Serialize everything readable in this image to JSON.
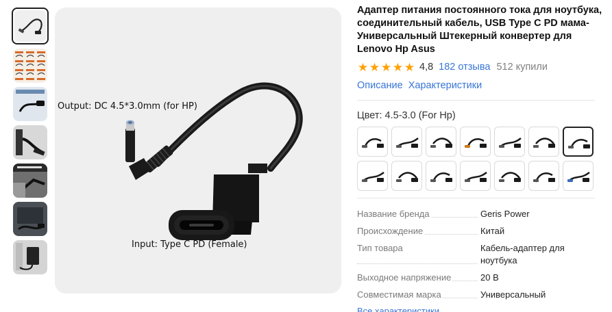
{
  "product": {
    "title": "Адаптер питания постоянного тока для ноутбука, соединительный кабель, USB Type C PD мама-Универсальный Штекерный конвертер для Lenovo Hp Asus",
    "rating_value": "4,8",
    "rating_stars": 5,
    "reviews_text": "182 отзыва",
    "bought_text": "512 купили"
  },
  "tabs": {
    "description": "Описание",
    "specifications": "Характеристики"
  },
  "image": {
    "caption_output": "Output: DC 4.5*3.0mm (for HP)",
    "caption_input": "Input: Type C PD (Female)"
  },
  "thumbnails": [
    {
      "name": "thumb-hp-cable",
      "active": true
    },
    {
      "name": "thumb-variants-grid",
      "active": false
    },
    {
      "name": "thumb-small-portable",
      "active": false
    },
    {
      "name": "thumb-laptop-connection",
      "active": false
    },
    {
      "name": "thumb-plug-and-charge",
      "active": false
    },
    {
      "name": "thumb-laptop-dark",
      "active": false
    },
    {
      "name": "thumb-charger",
      "active": false
    }
  ],
  "color": {
    "label": "Цвет: 4.5-3.0 (For Hp)",
    "selected_index": 6,
    "swatch_count": 14
  },
  "specs": [
    {
      "key": "Название бренда",
      "value": "Geris Power"
    },
    {
      "key": "Происхождение",
      "value": "Китай"
    },
    {
      "key": "Тип товара",
      "value": "Кабель-адаптер для ноутбука"
    },
    {
      "key": "Выходное напряжение",
      "value": "20 В"
    },
    {
      "key": "Совместимая марка",
      "value": "Универсальный"
    }
  ],
  "all_specs_link": "Все характеристики",
  "colors": {
    "accent_link": "#3876d6",
    "star": "#ffa000",
    "muted": "#808080",
    "image_bg": "#efefef"
  }
}
